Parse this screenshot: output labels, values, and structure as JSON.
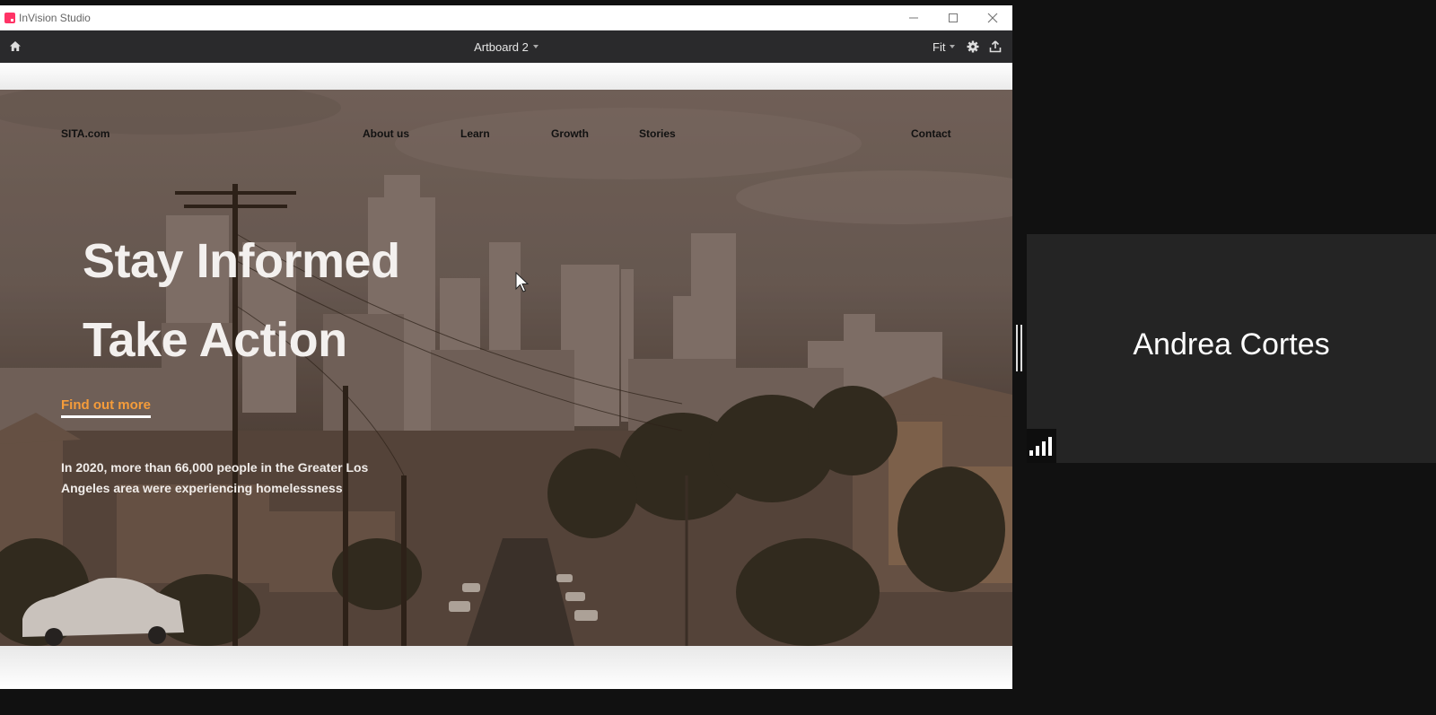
{
  "window": {
    "app_title": "InVision Studio",
    "accent_color": "#ff3366"
  },
  "toolbar": {
    "artboard_name": "Artboard 2",
    "zoom_label": "Fit",
    "icons": [
      "home-icon",
      "gear-icon",
      "export-icon"
    ]
  },
  "site": {
    "logo": "SITA.com",
    "nav": [
      "About us",
      "Learn",
      "Growth",
      "Stories"
    ],
    "contact": "Contact",
    "hero_line1": "Stay Informed",
    "hero_line2": "Take Action",
    "cta": "Find out more",
    "stat_line1": "In 2020, more than 66,000 people in the Greater Los",
    "stat_line2": "Angeles area were experiencing homelessness",
    "cta_color": "#f59c3a"
  },
  "video": {
    "participant_name": "Andrea Cortes"
  }
}
